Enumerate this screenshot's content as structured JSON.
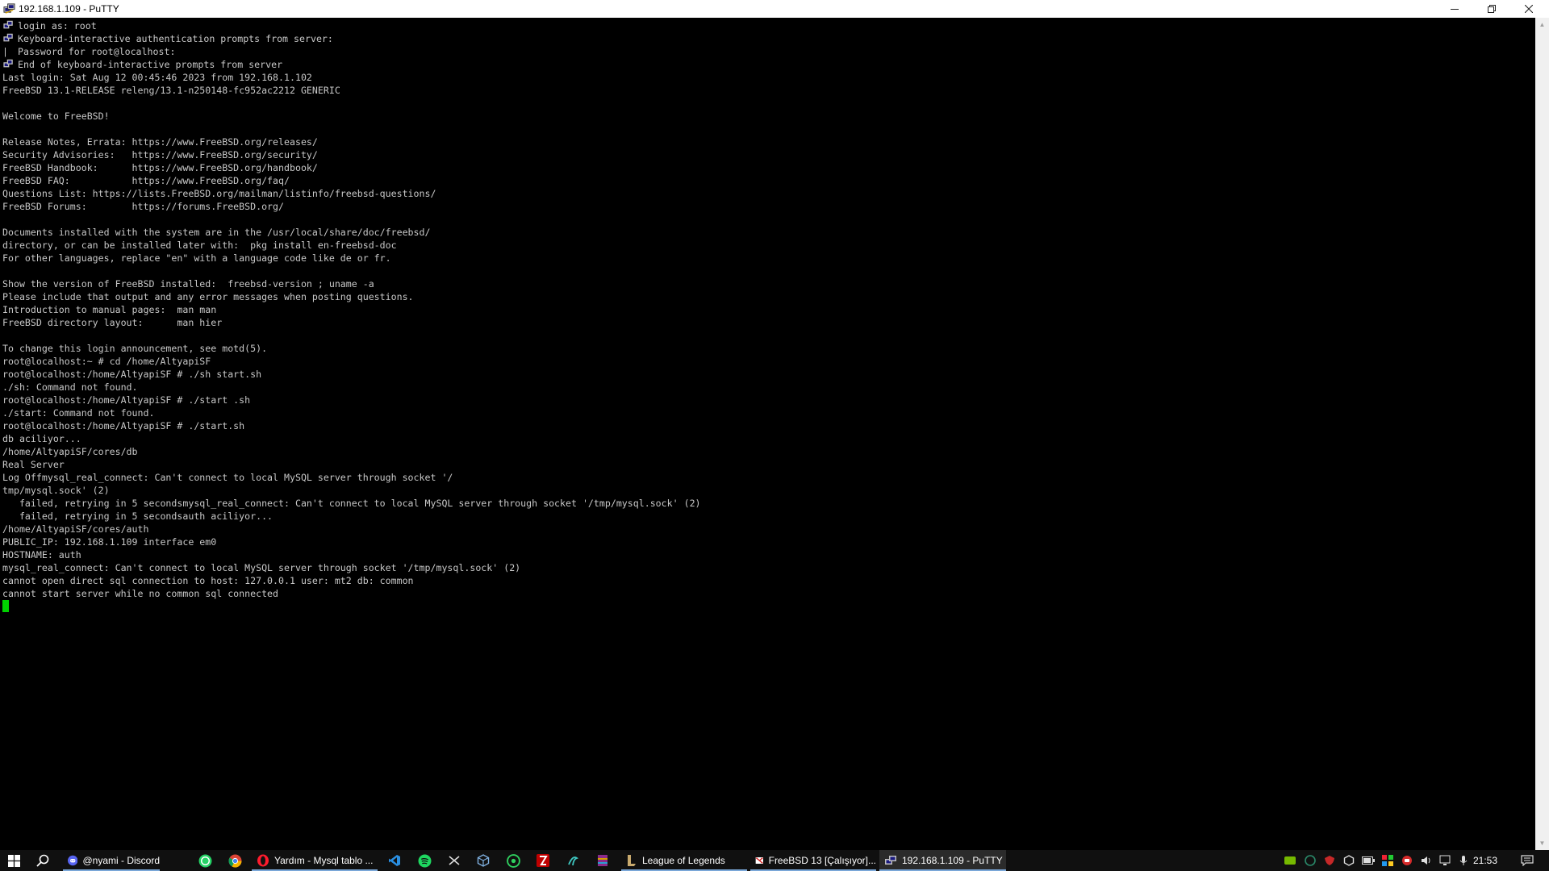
{
  "window": {
    "title": "192.168.1.109 - PuTTY"
  },
  "terminal": {
    "lines": [
      {
        "icon": "putty-key-icon",
        "text": "login as: root"
      },
      {
        "icon": "putty-key-icon",
        "text": "Keyboard-interactive authentication prompts from server:"
      },
      {
        "prefix": "|",
        "text": " Password for root@localhost:"
      },
      {
        "icon": "putty-key-icon",
        "text": "End of keyboard-interactive prompts from server"
      },
      {
        "text": "Last login: Sat Aug 12 00:45:46 2023 from 192.168.1.102"
      },
      {
        "text": "FreeBSD 13.1-RELEASE releng/13.1-n250148-fc952ac2212 GENERIC"
      },
      {
        "text": ""
      },
      {
        "text": "Welcome to FreeBSD!"
      },
      {
        "text": ""
      },
      {
        "text": "Release Notes, Errata: https://www.FreeBSD.org/releases/"
      },
      {
        "text": "Security Advisories:   https://www.FreeBSD.org/security/"
      },
      {
        "text": "FreeBSD Handbook:      https://www.FreeBSD.org/handbook/"
      },
      {
        "text": "FreeBSD FAQ:           https://www.FreeBSD.org/faq/"
      },
      {
        "text": "Questions List: https://lists.FreeBSD.org/mailman/listinfo/freebsd-questions/"
      },
      {
        "text": "FreeBSD Forums:        https://forums.FreeBSD.org/"
      },
      {
        "text": ""
      },
      {
        "text": "Documents installed with the system are in the /usr/local/share/doc/freebsd/"
      },
      {
        "text": "directory, or can be installed later with:  pkg install en-freebsd-doc"
      },
      {
        "text": "For other languages, replace \"en\" with a language code like de or fr."
      },
      {
        "text": ""
      },
      {
        "text": "Show the version of FreeBSD installed:  freebsd-version ; uname -a"
      },
      {
        "text": "Please include that output and any error messages when posting questions."
      },
      {
        "text": "Introduction to manual pages:  man man"
      },
      {
        "text": "FreeBSD directory layout:      man hier"
      },
      {
        "text": ""
      },
      {
        "text": "To change this login announcement, see motd(5)."
      },
      {
        "text": "root@localhost:~ # cd /home/AltyapiSF"
      },
      {
        "text": "root@localhost:/home/AltyapiSF # ./sh start.sh"
      },
      {
        "text": "./sh: Command not found."
      },
      {
        "text": "root@localhost:/home/AltyapiSF # ./start .sh"
      },
      {
        "text": "./start: Command not found."
      },
      {
        "text": "root@localhost:/home/AltyapiSF # ./start.sh"
      },
      {
        "text": "db aciliyor..."
      },
      {
        "text": "/home/AltyapiSF/cores/db"
      },
      {
        "text": "Real Server"
      },
      {
        "text": "Log Offmysql_real_connect: Can't connect to local MySQL server through socket '/"
      },
      {
        "text": "tmp/mysql.sock' (2)"
      },
      {
        "text": "   failed, retrying in 5 secondsmysql_real_connect: Can't connect to local MySQL server through socket '/tmp/mysql.sock' (2)"
      },
      {
        "text": "   failed, retrying in 5 secondsauth aciliyor..."
      },
      {
        "text": "/home/AltyapiSF/cores/auth"
      },
      {
        "text": "PUBLIC_IP: 192.168.1.109 interface em0"
      },
      {
        "text": "HOSTNAME: auth"
      },
      {
        "text": "mysql_real_connect: Can't connect to local MySQL server through socket '/tmp/mysql.sock' (2)"
      },
      {
        "text": "cannot open direct sql connection to host: 127.0.0.1 user: mt2 db: common"
      },
      {
        "text": "cannot start server while no common sql connected"
      }
    ],
    "cursor_color": "#00d000"
  },
  "taskbar": {
    "start_icon": "windows-start-icon",
    "search_icon": "search-icon",
    "apps": [
      {
        "label": "@nyami - Discord",
        "icon": "discord-icon"
      },
      {
        "label": "",
        "icon": "whatsapp-icon"
      },
      {
        "label": "",
        "icon": "chrome-icon"
      },
      {
        "label": "Yardım - Mysql tablo ...",
        "icon": "opera-icon"
      },
      {
        "label": "",
        "icon": "vscode-icon"
      },
      {
        "label": "",
        "icon": "spotify-icon"
      },
      {
        "label": "",
        "icon": "winscp-icon"
      },
      {
        "label": "",
        "icon": "virtualbox-icon"
      },
      {
        "label": "",
        "icon": "app-green-icon"
      },
      {
        "label": "",
        "icon": "filezilla-icon"
      },
      {
        "label": "",
        "icon": "app-teal-icon"
      },
      {
        "label": "",
        "icon": "winrar-icon"
      },
      {
        "label": "League of Legends",
        "icon": "league-icon"
      },
      {
        "label": "FreeBSD 13 [Çalışıyor]...",
        "icon": "virtualbox-vm-icon"
      },
      {
        "label": "192.168.1.109 - PuTTY",
        "icon": "putty-icon"
      }
    ],
    "clock": "21:53"
  },
  "colors": {
    "terminal_bg": "#000000",
    "terminal_fg": "#c8c8c8",
    "taskbar_bg": "#101010",
    "accent": "#7aa7d8"
  }
}
